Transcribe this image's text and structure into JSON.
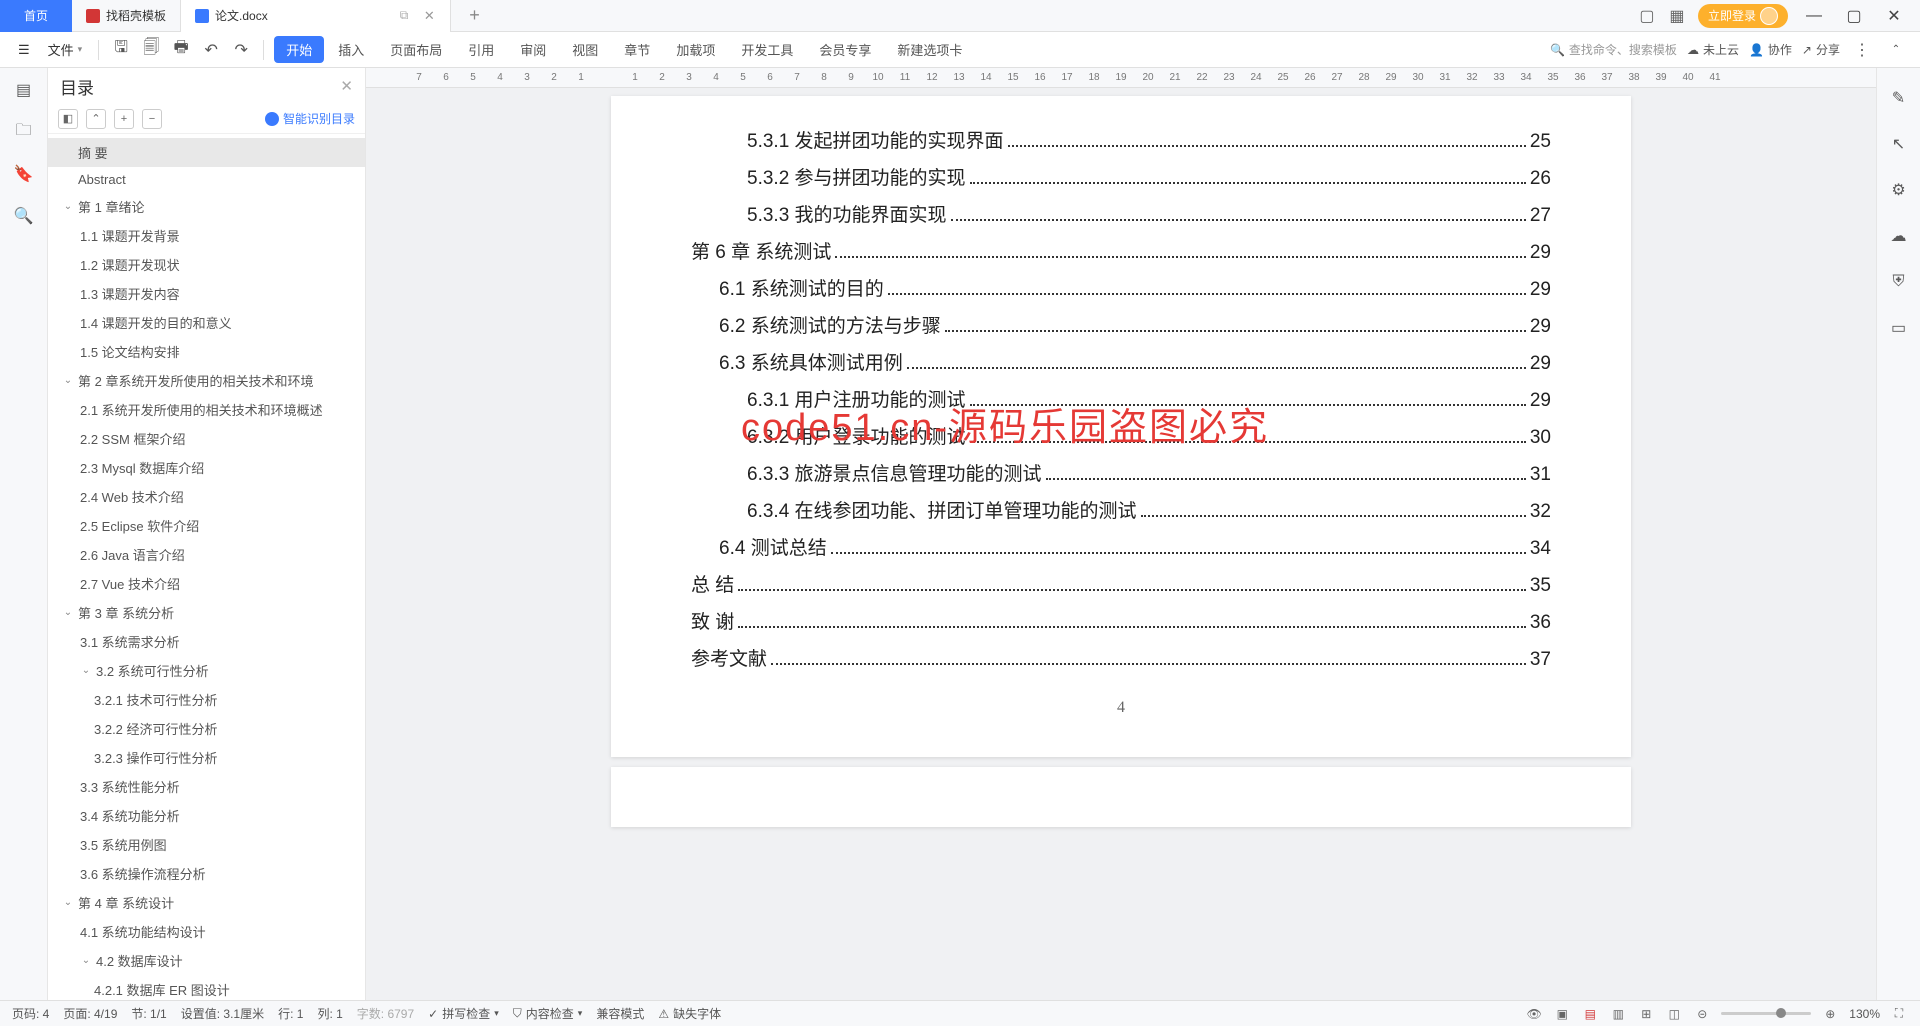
{
  "tabs": {
    "home": "首页",
    "template": "找稻壳模板",
    "doc": "论文.docx"
  },
  "login": "立即登录",
  "file_menu": "文件",
  "menubar": [
    "开始",
    "插入",
    "页面布局",
    "引用",
    "审阅",
    "视图",
    "章节",
    "加载项",
    "开发工具",
    "会员专享",
    "新建选项卡"
  ],
  "search_placeholder": "查找命令、搜索模板",
  "cloud": {
    "not_uploaded": "未上云",
    "coop": "协作",
    "share": "分享"
  },
  "outline": {
    "title": "目录",
    "ai_link": "智能识别目录",
    "items": [
      {
        "label": "摘 要",
        "level": 0,
        "chev": "",
        "selected": true
      },
      {
        "label": "Abstract",
        "level": 0,
        "chev": ""
      },
      {
        "label": "第 1 章绪论",
        "level": 1,
        "chev": "v"
      },
      {
        "label": "1.1 课题开发背景",
        "level": 2
      },
      {
        "label": "1.2 课题开发现状",
        "level": 2
      },
      {
        "label": "1.3 课题开发内容",
        "level": 2
      },
      {
        "label": "1.4 课题开发的目的和意义",
        "level": 2
      },
      {
        "label": "1.5 论文结构安排",
        "level": 2
      },
      {
        "label": "第 2 章系统开发所使用的相关技术和环境",
        "level": 1,
        "chev": "v"
      },
      {
        "label": "2.1 系统开发所使用的相关技术和环境概述",
        "level": 2
      },
      {
        "label": "2.2 SSM 框架介绍",
        "level": 2
      },
      {
        "label": "2.3 Mysql 数据库介绍",
        "level": 2
      },
      {
        "label": "2.4 Web 技术介绍",
        "level": 2
      },
      {
        "label": "2.5 Eclipse 软件介绍",
        "level": 2
      },
      {
        "label": "2.6 Java 语言介绍",
        "level": 2
      },
      {
        "label": "2.7 Vue 技术介绍",
        "level": 2
      },
      {
        "label": "第 3 章  系统分析",
        "level": 1,
        "chev": "v"
      },
      {
        "label": "3.1 系统需求分析",
        "level": 2
      },
      {
        "label": "3.2 系统可行性分析",
        "level": 2,
        "chev": "v"
      },
      {
        "label": "3.2.1 技术可行性分析",
        "level": 3
      },
      {
        "label": "3.2.2 经济可行性分析",
        "level": 3
      },
      {
        "label": "3.2.3 操作可行性分析",
        "level": 3
      },
      {
        "label": "3.3 系统性能分析",
        "level": 2
      },
      {
        "label": "3.4 系统功能分析",
        "level": 2
      },
      {
        "label": "3.5 系统用例图",
        "level": 2
      },
      {
        "label": "3.6 系统操作流程分析",
        "level": 2
      },
      {
        "label": "第 4 章  系统设计",
        "level": 1,
        "chev": "v"
      },
      {
        "label": "4.1 系统功能结构设计",
        "level": 2
      },
      {
        "label": "4.2 数据库设计",
        "level": 2,
        "chev": "v"
      },
      {
        "label": "4.2.1 数据库 ER 图设计",
        "level": 3
      }
    ]
  },
  "ruler": [
    "7",
    "6",
    "5",
    "4",
    "3",
    "2",
    "1",
    "",
    "1",
    "2",
    "3",
    "4",
    "5",
    "6",
    "7",
    "8",
    "9",
    "10",
    "11",
    "12",
    "13",
    "14",
    "15",
    "16",
    "17",
    "18",
    "19",
    "20",
    "21",
    "22",
    "23",
    "24",
    "25",
    "26",
    "27",
    "28",
    "29",
    "30",
    "31",
    "32",
    "33",
    "34",
    "35",
    "36",
    "37",
    "38",
    "39",
    "40",
    "41"
  ],
  "doc_toc": [
    {
      "title": "5.3.1 发起拼团功能的实现界面",
      "page": "25",
      "level": 3
    },
    {
      "title": "5.3.2 参与拼团功能的实现",
      "page": "26",
      "level": 3
    },
    {
      "title": "5.3.3 我的功能界面实现",
      "page": "27",
      "level": 3
    },
    {
      "title": "第 6 章  系统测试",
      "page": "29",
      "level": 1
    },
    {
      "title": "6.1 系统测试的目的",
      "page": "29",
      "level": 2
    },
    {
      "title": "6.2 系统测试的方法与步骤",
      "page": "29",
      "level": 2
    },
    {
      "title": "6.3 系统具体测试用例",
      "page": "29",
      "level": 2
    },
    {
      "title": "6.3.1 用户注册功能的测试",
      "page": "29",
      "level": 3
    },
    {
      "title": "6.3.2 用户登录功能的测试",
      "page": "30",
      "level": 3
    },
    {
      "title": "6.3.3 旅游景点信息管理功能的测试",
      "page": "31",
      "level": 3
    },
    {
      "title": "6.3.4 在线参团功能、拼团订单管理功能的测试",
      "page": "32",
      "level": 3
    },
    {
      "title": "6.4 测试总结",
      "page": "34",
      "level": 2
    },
    {
      "title": "总  结",
      "page": "35",
      "level": 1
    },
    {
      "title": "致  谢",
      "page": "36",
      "level": 1
    },
    {
      "title": "参考文献",
      "page": "37",
      "level": 1
    }
  ],
  "page_footer": "4",
  "watermark": "code51.cn-源码乐园盗图必究",
  "statusbar": {
    "page_code": "页码: 4",
    "page": "页面: 4/19",
    "section": "节: 1/1",
    "setting": "设置值: 3.1厘米",
    "row": "行: 1",
    "col": "列: 1",
    "words": "字数: 6797",
    "spell": "拼写检查",
    "content": "内容检查",
    "compat": "兼容模式",
    "missing": "缺失字体",
    "zoom": "130%"
  }
}
